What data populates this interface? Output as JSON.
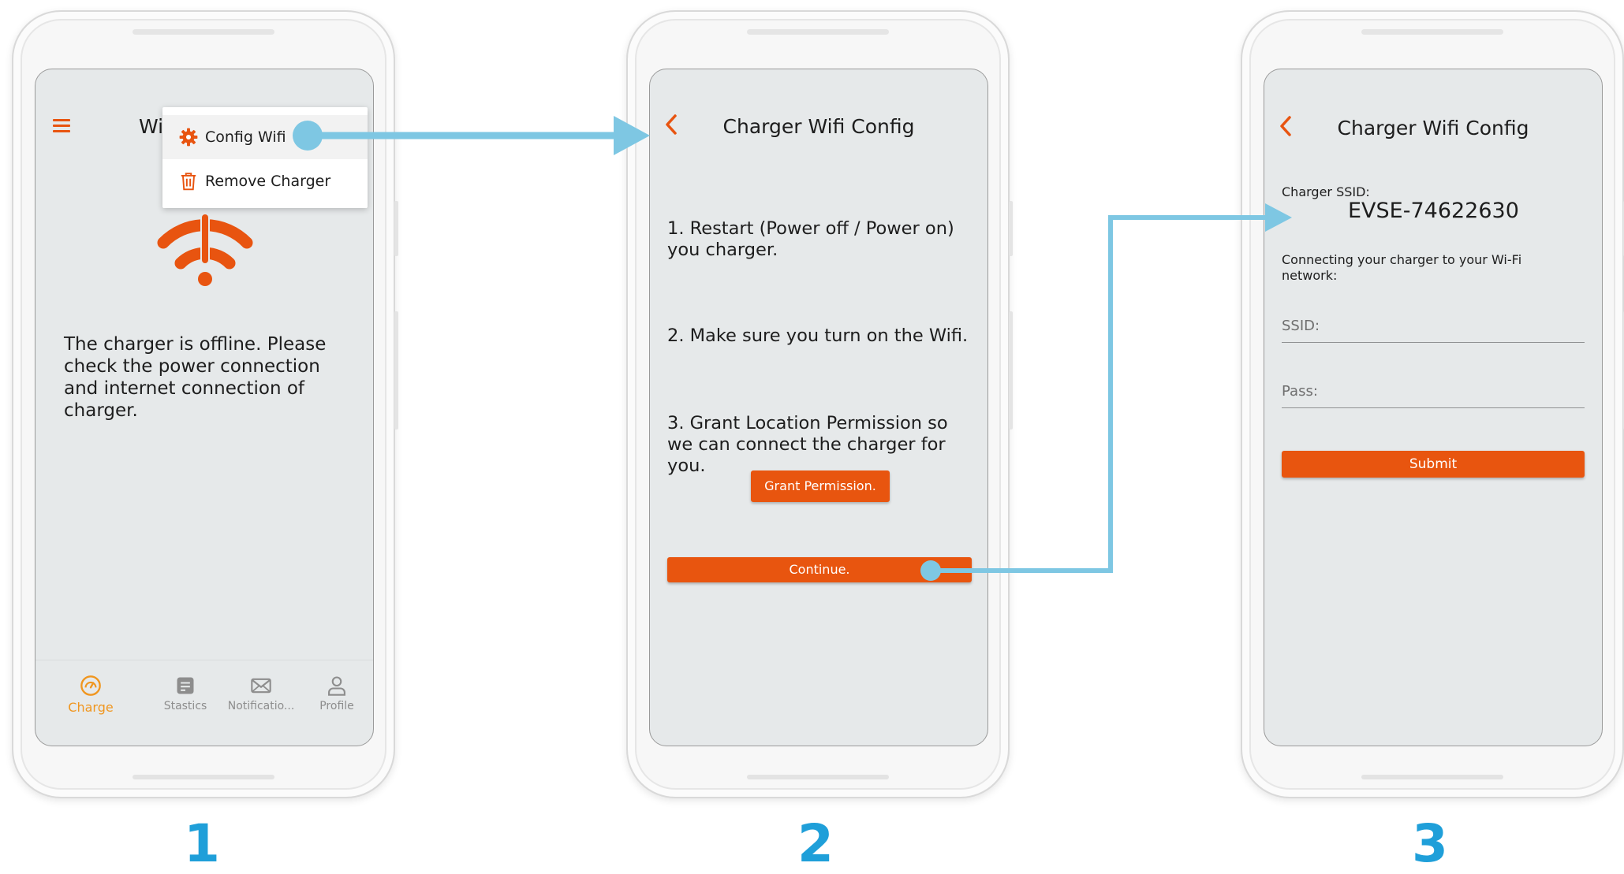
{
  "colors": {
    "accent": "#e85410",
    "tab_active": "#f0961f",
    "flow": "#7ec7e3",
    "step_number": "#1f9fd9"
  },
  "screen1": {
    "title_partial": "Wi",
    "menu": [
      {
        "label": "Config Wifi",
        "icon": "gear-icon"
      },
      {
        "label": "Remove Charger",
        "icon": "trash-icon"
      }
    ],
    "status_icon": "wifi-off-icon",
    "offline_message": "The charger is offline. Please check the power connection and internet connection of charger.",
    "tabs": [
      {
        "label": "Charge",
        "icon": "charge-gauge-icon",
        "active": true
      },
      {
        "label": "Stastics",
        "icon": "stats-icon",
        "active": false
      },
      {
        "label": "Notificatio...",
        "icon": "mail-icon",
        "active": false
      },
      {
        "label": "Profile",
        "icon": "person-icon",
        "active": false
      }
    ]
  },
  "screen2": {
    "title": "Charger Wifi Config",
    "step1": "1. Restart (Power off / Power on) you charger.",
    "step2": "2. Make sure you turn on the Wifi.",
    "step3": "3. Grant Location Permission so we can connect the charger for you.",
    "grant_button": "Grant Permission.",
    "continue_button": "Continue."
  },
  "screen3": {
    "title": "Charger Wifi Config",
    "ssid_label": "Charger SSID:",
    "ssid_value": "EVSE-74622630",
    "connect_text": "Connecting your charger to your Wi-Fi network:",
    "ssid_field": "SSID:",
    "pass_field": "Pass:",
    "submit_button": "Submit"
  },
  "steps": [
    "1",
    "2",
    "3"
  ]
}
